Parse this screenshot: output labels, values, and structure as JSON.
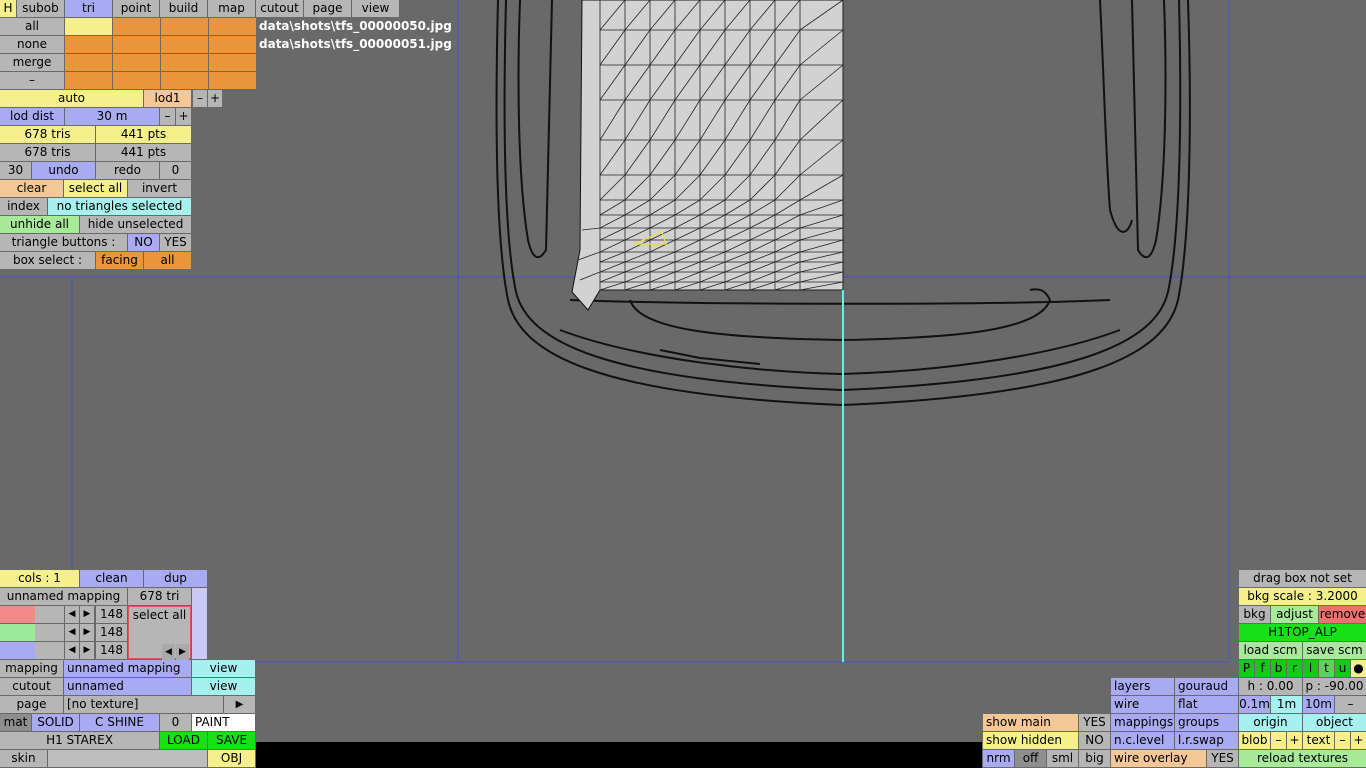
{
  "top_tabs": [
    "H",
    "subob",
    "tri",
    "point",
    "build",
    "map",
    "cutout",
    "page",
    "view"
  ],
  "files": [
    "data\\shots\\tfs_00000050.jpg",
    "data\\shots\\tfs_00000051.jpg"
  ],
  "sel_rows": [
    "all",
    "none",
    "merge",
    "–"
  ],
  "lod": {
    "auto": "auto",
    "lod1": "lod1",
    "minus": "–",
    "plus": "+",
    "dist_label": "lod dist",
    "dist_value": "30 m"
  },
  "stats": {
    "tris1": "678 tris",
    "pts1": "441 pts",
    "tris2": "678 tris",
    "pts2": "441 pts"
  },
  "undo": {
    "count": "30",
    "undo": "undo",
    "redo": "redo",
    "zero": "0"
  },
  "select": {
    "clear": "clear",
    "select_all": "select all",
    "invert": "invert",
    "index": "index",
    "status": "no triangles selected",
    "unhide_all": "unhide all",
    "hide_unselected": "hide unselected",
    "tri_buttons": "triangle buttons :",
    "no": "NO",
    "yes": "YES",
    "box_select": "box select :",
    "facing": "facing",
    "all": "all"
  },
  "mapping_panel": {
    "cols": "cols : 1",
    "clean": "clean",
    "dup": "dup",
    "unnamed_mapping": "unnamed mapping",
    "tri_count": "678 tri",
    "v1": "148",
    "v2": "148",
    "v3": "148",
    "select_all": "select all"
  },
  "bottom_left": {
    "mapping": "mapping",
    "mapping_val": "unnamed mapping",
    "view1": "view",
    "cutout": "cutout",
    "cutout_val": "unnamed",
    "view2": "view",
    "page": "page",
    "page_val": "[no texture]",
    "arrow": "▶",
    "mat": "mat",
    "solid": "SOLID",
    "cshine": "C SHINE",
    "zero": "0",
    "paint": "PAINT",
    "object_name": "H1 STAREX",
    "load": "LOAD",
    "save": "SAVE",
    "skin": "skin",
    "obj": "OBJ"
  },
  "bottom_mid": {
    "show_main": "show main",
    "yes1": "YES",
    "show_hidden": "show hidden",
    "no1": "NO",
    "nrm": "nrm",
    "off": "off",
    "sml": "sml",
    "big": "big",
    "layers": "layers",
    "gouraud": "gouraud",
    "wire": "wire",
    "flat": "flat",
    "mappings": "mappings",
    "groups": "groups",
    "nclevel": "n.c.level",
    "lrswap": "l.r.swap",
    "wire_overlay": "wire overlay",
    "yes2": "YES"
  },
  "right_panel": {
    "drag_box": "drag box not set",
    "bkg_scale": "bkg scale : 3.2000",
    "bkg": "bkg",
    "adjust": "adjust",
    "remove": "remove",
    "name": "H1TOP_ALP",
    "load_scm": "load scm",
    "save_scm": "save scm",
    "views": [
      "P",
      "f",
      "b",
      "r",
      "l",
      "t",
      "u",
      "●"
    ],
    "h": "h : 0.00",
    "p": "p : -90.00",
    "s1": "0.1m",
    "s2": "1m",
    "s3": "10m",
    "minus": "–",
    "origin": "origin",
    "object": "object",
    "blob": "blob",
    "text": "text",
    "m": "–",
    "p_": "+",
    "reload": "reload textures"
  },
  "colors": {
    "orange": "#e8953c",
    "yellow": "#f6f08c",
    "blue": "#a9abf2",
    "cyan": "#a7f0f0",
    "green": "#18e018",
    "red": "#f06f6f"
  }
}
